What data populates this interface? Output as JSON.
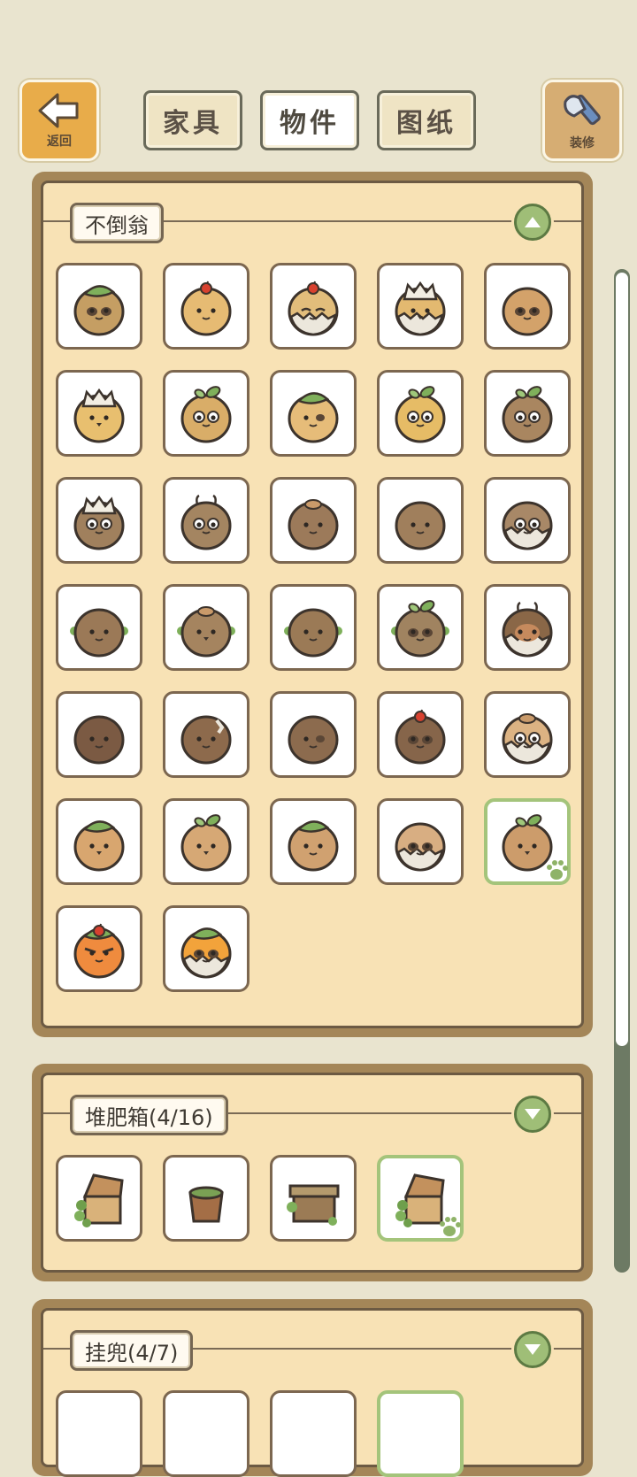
{
  "header": {
    "back_label": "返回",
    "decorate_label": "装修",
    "tabs": [
      {
        "label": "家具",
        "active": false
      },
      {
        "label": "物件",
        "active": true
      },
      {
        "label": "图纸",
        "active": false
      }
    ]
  },
  "sections": [
    {
      "title": "不倒翁",
      "expanded": true,
      "toggle_icon": "chevron-up-icon",
      "items": [
        {
          "body": "#c59e63",
          "top": "leaf",
          "face": "mask",
          "owned": false
        },
        {
          "body": "#e6bb73",
          "top": "cherry",
          "face": "plain",
          "owned": false
        },
        {
          "body": "#e2bd7b",
          "top": "cherry",
          "face": "sleep",
          "shell": true,
          "owned": false
        },
        {
          "body": "#e3b970",
          "top": "shell",
          "face": "beak",
          "shell": true,
          "owned": false
        },
        {
          "body": "#d3a26a",
          "top": "none",
          "face": "mask",
          "owned": false
        },
        {
          "body": "#e8bf6f",
          "top": "shell",
          "face": "beak",
          "owned": false
        },
        {
          "body": "#d9ad68",
          "top": "sprout",
          "face": "goggle",
          "owned": false
        },
        {
          "body": "#e6bc79",
          "top": "leaf",
          "face": "pirate",
          "owned": false
        },
        {
          "body": "#e6bc66",
          "top": "sprout2",
          "face": "goggle",
          "owned": false
        },
        {
          "body": "#a98660",
          "top": "sprout",
          "face": "glasses",
          "owned": false
        },
        {
          "body": "#a0805d",
          "top": "shell",
          "face": "glasses",
          "owned": false
        },
        {
          "body": "#a48561",
          "top": "antenna",
          "face": "goggle",
          "owned": false
        },
        {
          "body": "#9c7a5a",
          "top": "cap",
          "face": "plain",
          "owned": false
        },
        {
          "body": "#a07f5c",
          "top": "none",
          "face": "plain",
          "owned": false
        },
        {
          "body": "#a88867",
          "top": "none",
          "face": "bigeye",
          "shell": true,
          "owned": false
        },
        {
          "body": "#9b7957",
          "top": "arms",
          "face": "plain",
          "owned": false
        },
        {
          "body": "#a5845f",
          "top": "cap_arms",
          "face": "beak",
          "owned": false
        },
        {
          "body": "#9b7a56",
          "top": "arms",
          "face": "plain",
          "owned": false
        },
        {
          "body": "#a08360",
          "top": "sprout_arms",
          "face": "mask",
          "owned": false
        },
        {
          "body": "#8a6747",
          "top": "antenna",
          "face": "owl",
          "shell": true,
          "owned": false
        },
        {
          "body": "#7b5a43",
          "top": "none",
          "face": "dark",
          "owned": false
        },
        {
          "body": "#8d6a4c",
          "top": "crack",
          "face": "dark",
          "owned": false
        },
        {
          "body": "#8c6b4e",
          "top": "none",
          "face": "pirate",
          "owned": false
        },
        {
          "body": "#86654a",
          "top": "cherry",
          "face": "panda",
          "owned": false
        },
        {
          "body": "#dcb383",
          "top": "cap",
          "face": "goggle",
          "shell": true,
          "owned": false
        },
        {
          "body": "#d8a66f",
          "top": "bigleaf",
          "face": "beak",
          "owned": false
        },
        {
          "body": "#d6a875",
          "top": "sprout2",
          "face": "beak",
          "owned": false
        },
        {
          "body": "#d0a170",
          "top": "leaf",
          "face": "plain",
          "owned": false
        },
        {
          "body": "#d8ae82",
          "top": "none",
          "face": "mask",
          "shell": true,
          "owned": false
        },
        {
          "body": "#cc9c6b",
          "top": "sprout",
          "face": "beak",
          "owned": true
        },
        {
          "body": "#ef8b3e",
          "top": "cherry_leaf",
          "face": "angry",
          "owned": false
        },
        {
          "body": "#f2a33b",
          "top": "leaf",
          "face": "panda",
          "shell": true,
          "owned": false
        }
      ]
    },
    {
      "title": "堆肥箱(4/16)",
      "expanded": false,
      "toggle_icon": "chevron-down-icon",
      "items": [
        {
          "kind": "chest",
          "owned": false
        },
        {
          "kind": "bucket",
          "owned": false
        },
        {
          "kind": "crate",
          "owned": false
        },
        {
          "kind": "chest",
          "owned": true
        }
      ]
    },
    {
      "title": "挂兜(4/7)",
      "expanded": false,
      "toggle_icon": "chevron-down-icon",
      "items": []
    }
  ],
  "scrollbar": {
    "position_fraction": 0.0,
    "visible_fraction": 0.77
  },
  "colors": {
    "background": "#e9e4cf",
    "panel_fill": "#f8e2b5",
    "panel_frame": "#a48658",
    "owned_border": "#a4c47b",
    "toggle": "#9fbe77"
  }
}
